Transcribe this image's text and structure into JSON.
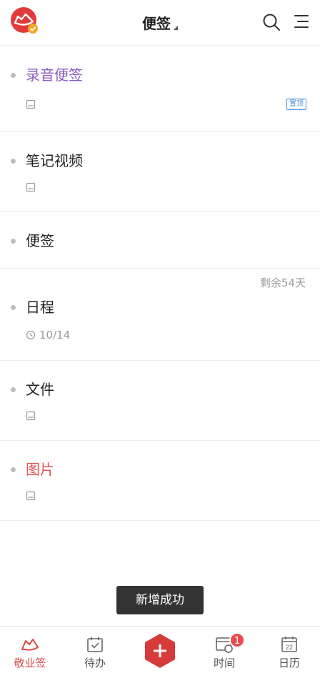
{
  "header": {
    "title": "便签"
  },
  "notes": [
    {
      "title": "录音便签",
      "title_color": "#8a5bc6",
      "pinned_label": "置顶"
    },
    {
      "title": "笔记视频",
      "title_color": "#222222"
    },
    {
      "title": "便签",
      "title_color": "#222222"
    },
    {
      "title": "日程",
      "title_color": "#222222",
      "remaining": "剩余54天",
      "date": "10/14"
    },
    {
      "title": "文件",
      "title_color": "#222222"
    },
    {
      "title": "图片",
      "title_color": "#e05555"
    }
  ],
  "toast": "新增成功",
  "tabbar": {
    "items": [
      {
        "label": "敬业签",
        "active": true
      },
      {
        "label": "待办"
      },
      {
        "label": "时间",
        "badge": "1"
      },
      {
        "label": "日历",
        "calendar_day": "22"
      }
    ]
  },
  "colors": {
    "accent": "#d94a4a",
    "pin_badge": "#4a90e2"
  }
}
